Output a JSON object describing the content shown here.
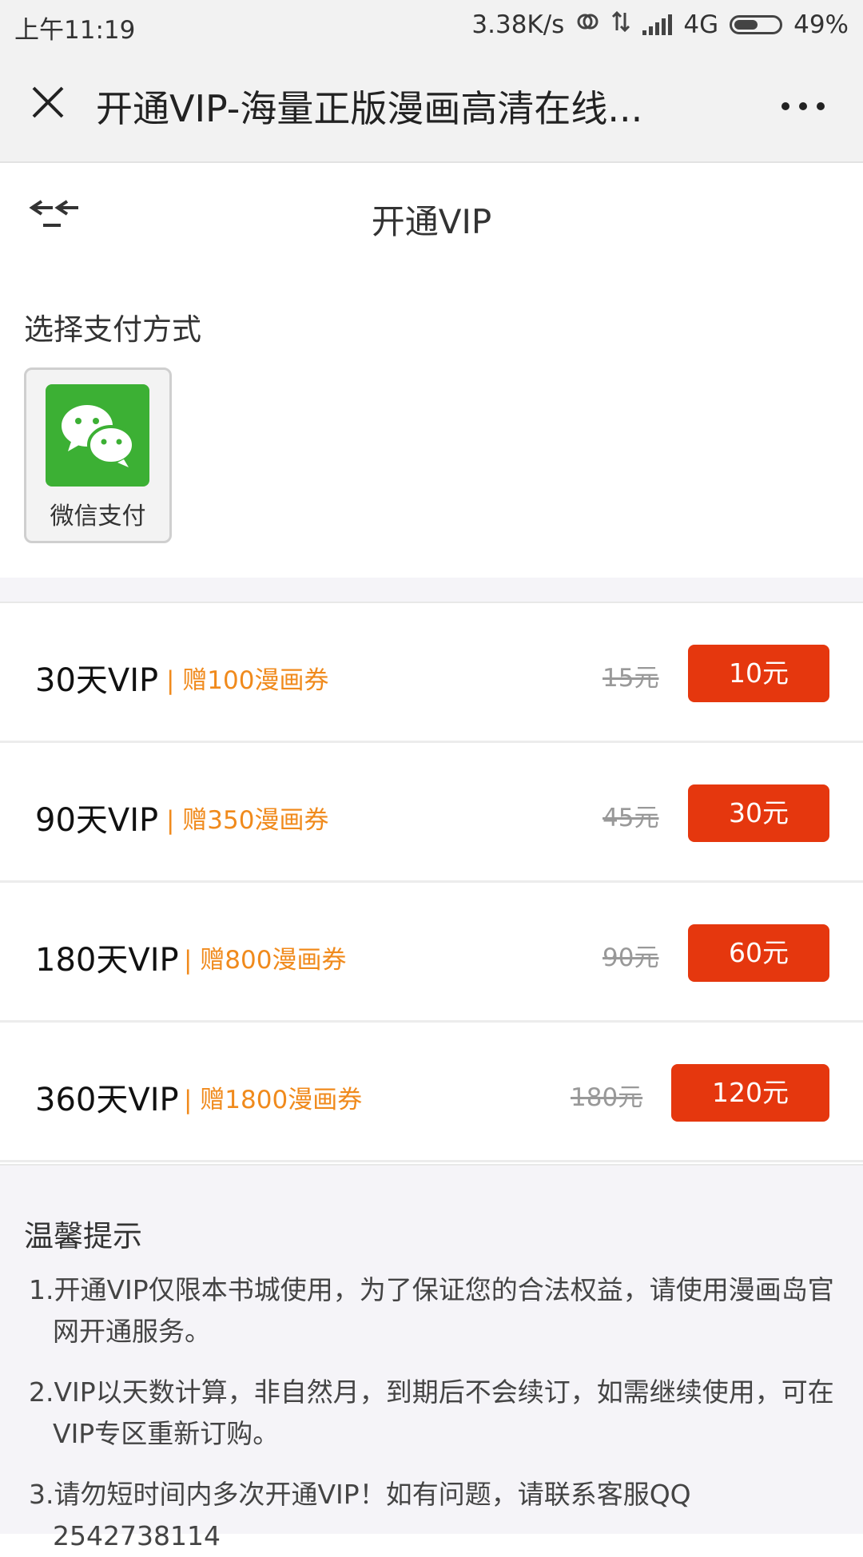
{
  "status_bar": {
    "time": "上午11:19",
    "speed": "3.38K/s",
    "network": "4G",
    "battery": "49%"
  },
  "webview": {
    "title": "开通VIP-海量正版漫画高清在线..."
  },
  "page": {
    "title": "开通VIP"
  },
  "payment": {
    "label": "选择支付方式",
    "method_label": "微信支付",
    "method_color": "#3cb034"
  },
  "plans": [
    {
      "name": "30天VIP",
      "gift": "| 赠100漫画券",
      "original": "15元",
      "price": "10元"
    },
    {
      "name": "90天VIP",
      "gift": "| 赠350漫画券",
      "original": "45元",
      "price": "30元"
    },
    {
      "name": "180天VIP",
      "gift": "| 赠800漫画券",
      "original": "90元",
      "price": "60元"
    },
    {
      "name": "360天VIP",
      "gift": "| 赠1800漫画券",
      "original": "180元",
      "price": "120元"
    }
  ],
  "tips": {
    "title": "温馨提示",
    "items": [
      "1.开通VIP仅限本书城使用，为了保证您的合法权益，请使用漫画岛官网开通服务。",
      "2.VIP以天数计算，非自然月，到期后不会续订，如需继续使用，可在VIP专区重新订购。",
      "3.请勿短时间内多次开通VIP！如有问题，请联系客服QQ 2542738114"
    ]
  },
  "colors": {
    "accent": "#e5370e",
    "gift": "#f08a1c"
  }
}
